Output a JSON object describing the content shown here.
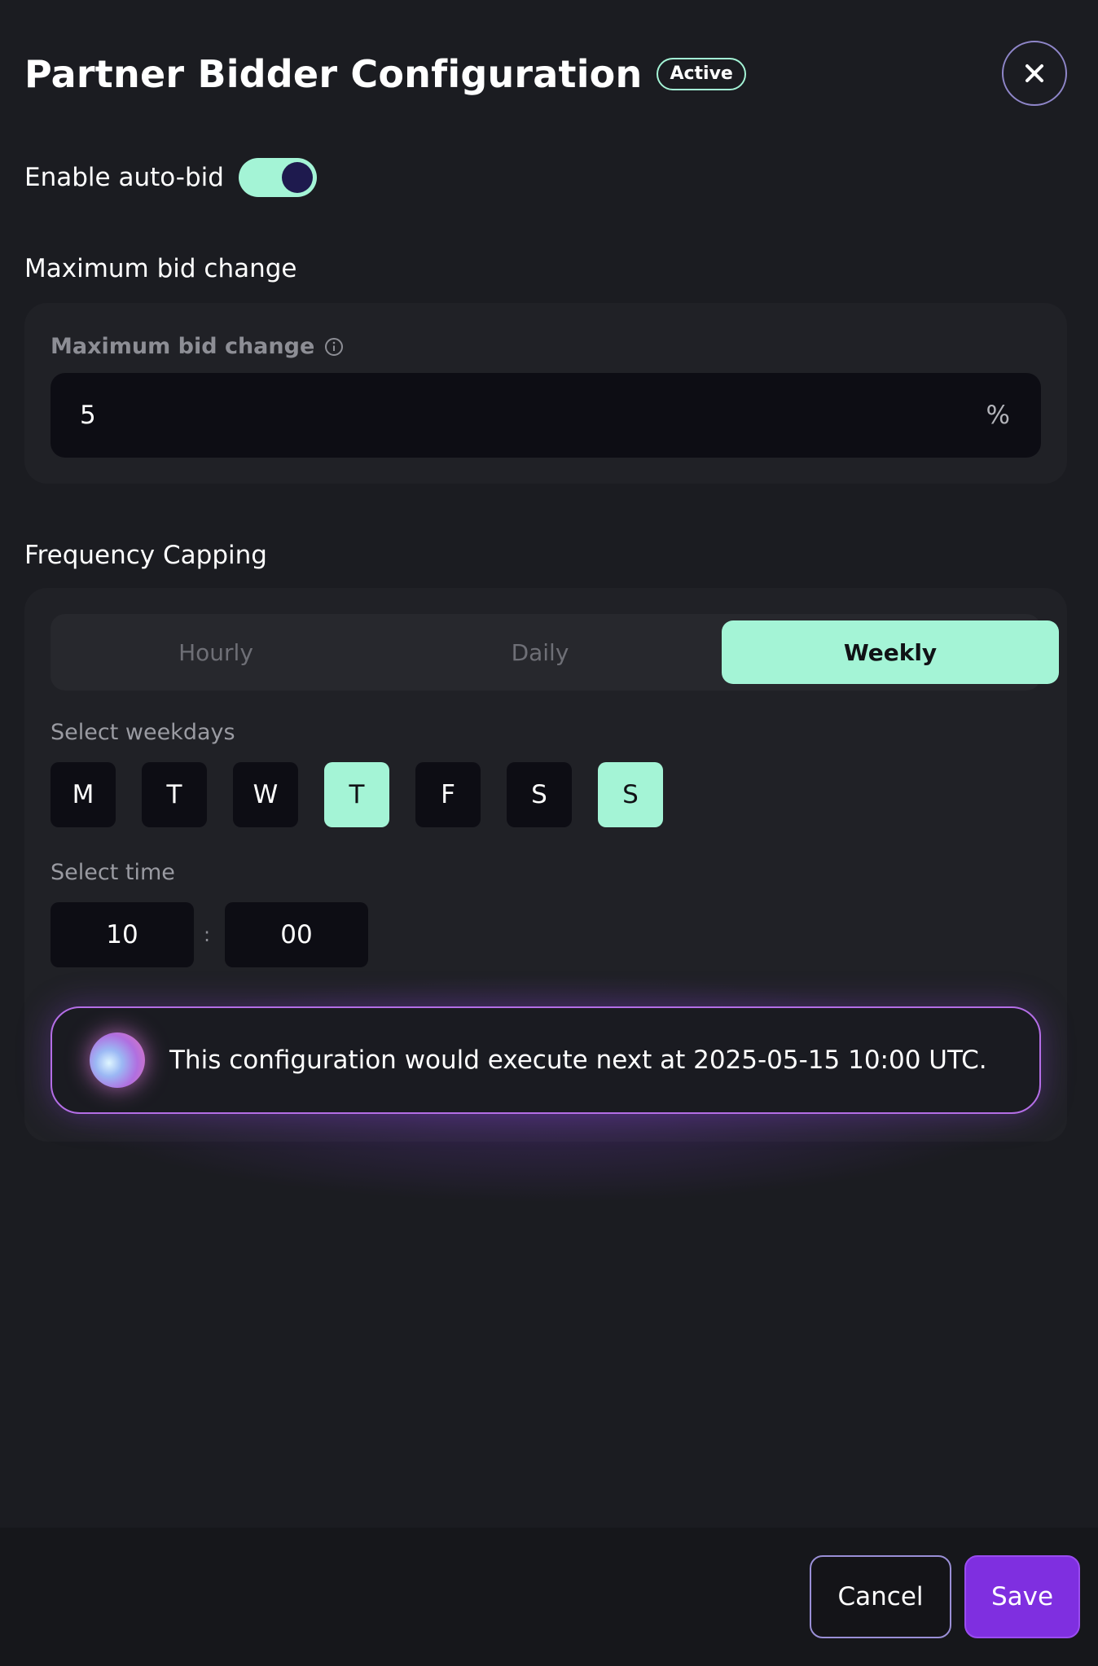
{
  "header": {
    "title": "Partner Bidder Configuration",
    "status_badge": "Active",
    "close_icon": "close-icon"
  },
  "auto_bid": {
    "label": "Enable auto-bid",
    "enabled": true
  },
  "max_bid": {
    "section_heading": "Maximum bid change",
    "field_label": "Maximum bid change",
    "info_icon": "info-icon",
    "value": "5",
    "suffix": "%"
  },
  "frequency": {
    "section_heading": "Frequency Capping",
    "tabs": [
      {
        "label": "Hourly",
        "active": false
      },
      {
        "label": "Daily",
        "active": false
      },
      {
        "label": "Weekly",
        "active": true
      }
    ],
    "weekdays_label": "Select weekdays",
    "weekdays": [
      {
        "label": "M",
        "selected": false
      },
      {
        "label": "T",
        "selected": false
      },
      {
        "label": "W",
        "selected": false
      },
      {
        "label": "T",
        "selected": true
      },
      {
        "label": "F",
        "selected": false
      },
      {
        "label": "S",
        "selected": false
      },
      {
        "label": "S",
        "selected": true
      }
    ],
    "time_label": "Select time",
    "hour": "10",
    "separator": ":",
    "minute": "00",
    "notice": "This configuration would execute next at 2025-05-15 10:00 UTC."
  },
  "footer": {
    "cancel_label": "Cancel",
    "save_label": "Save"
  },
  "colors": {
    "accent": "#a4f4d6",
    "primary": "#7f2fe0",
    "background": "#1b1c21"
  }
}
